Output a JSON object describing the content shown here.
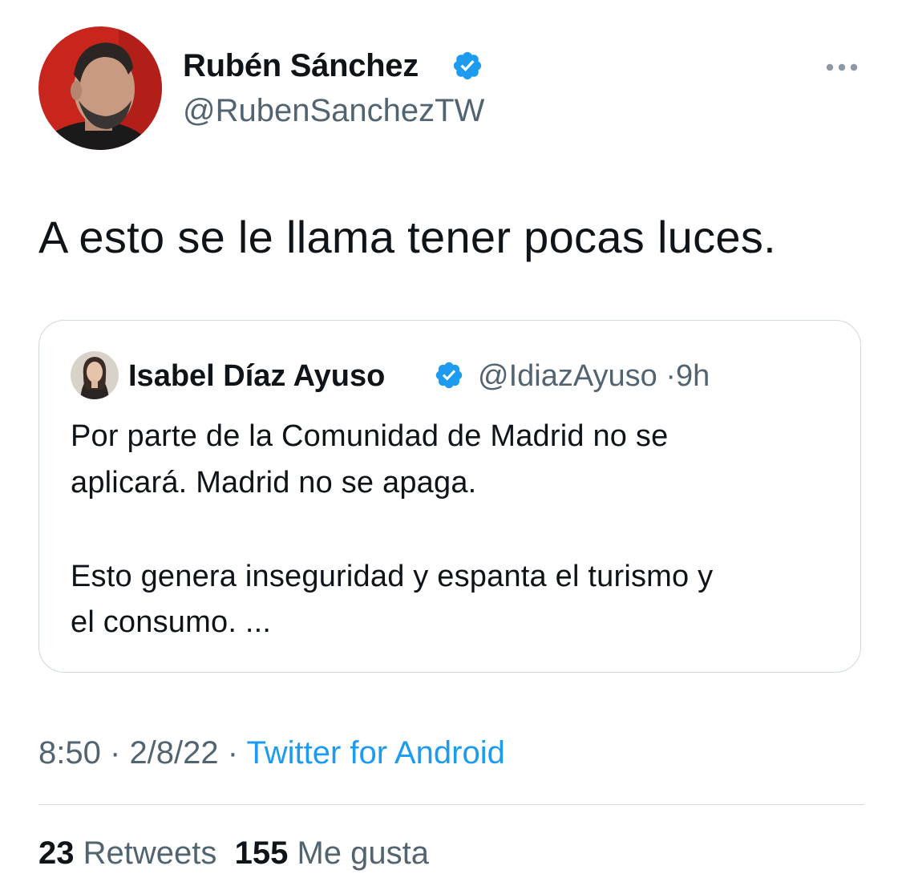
{
  "tweet": {
    "author_name": "Rubén Sánchez",
    "author_handle": "@RubenSanchezTW",
    "text": "A esto se le llama tener pocas luces.",
    "more_icon": "more-horizontal-icon",
    "verified_icon": "verified-badge-icon",
    "accent_color": "#1d9bf0"
  },
  "quote": {
    "author_name": "Isabel Díaz Ayuso",
    "author_handle": "@IdiazAyuso",
    "separator": "·",
    "time_ago": "9h",
    "lines": [
      "Por parte de la Comunidad de Madrid no se",
      "aplicará. Madrid no se apaga.",
      "Esto genera inseguridad y espanta el turismo y",
      "el consumo. ..."
    ]
  },
  "footer": {
    "time": "8:50",
    "date": "2/8/22",
    "separator": "·",
    "source": "Twitter for Android",
    "retweets_count": "23",
    "retweets_label": "Retweets",
    "likes_count": "155",
    "likes_label": "Me gusta"
  }
}
